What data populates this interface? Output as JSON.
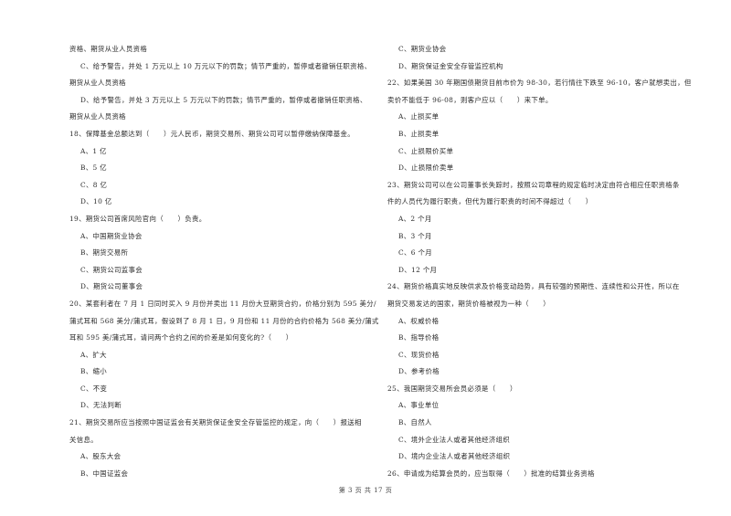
{
  "left_column": {
    "continuation": [
      "资格、期货从业人员资格"
    ],
    "q17_options_cd": [
      {
        "label": "C",
        "text": "C、给予警告，并处 1 万元以上 10 万元以下的罚款；情节严重的，暂停或者撤销任职资格、",
        "cont": "期货从业人员资格"
      },
      {
        "label": "D",
        "text": "D、给予警告，并处 3 万元以上 5 万元以下的罚款；情节严重的，暂停或者撤销任职资格、",
        "cont": "期货从业人员资格"
      }
    ],
    "q18": {
      "stem": "18、保障基金总额达到（　　）元人民币，期货交易所、期货公司可以暂停缴纳保障基金。",
      "options": [
        "A、1 亿",
        "B、5 亿",
        "C、8 亿",
        "D、10 亿"
      ]
    },
    "q19": {
      "stem": "19、期货公司首席风险官向（　　）负责。",
      "options": [
        "A、中国期货业协会",
        "B、期货交易所",
        "C、期货公司监事会",
        "D、期货公司董事会"
      ]
    },
    "q20": {
      "stem_lines": [
        "20、某套利者在 7 月 1 日同时买入 9 月份并卖出 11 月份大豆期货合约，价格分别为 595 美分/",
        "蒲式耳和 568 美分/蒲式耳，假设到了 8 月 1 日，9 月份和 11 月份的合约价格为 568 美分/蒲式",
        "耳和 595 美/蒲式耳，请问两个合约之间的价差是如何变化的?（　　）"
      ],
      "options": [
        "A、扩大",
        "B、缩小",
        "C、不变",
        "D、无法判断"
      ]
    },
    "q21": {
      "stem_lines": [
        "21、期货交易所应当按照中国证监会有关期货保证金安全存管监控的规定，向（　　）报送相",
        "关信息。"
      ],
      "options": [
        "A、股东大会",
        "B、中国证监会"
      ]
    }
  },
  "right_column": {
    "q21_options_cd": [
      "C、期货业协会",
      "D、期货保证金安全存管监控机构"
    ],
    "q22": {
      "stem_lines": [
        "22、如果美国 30 年期国债期货目前市价为 98-30，若行情往下跌至 96-10，客户就想卖出，但",
        "卖价不能低于 96-08，则客户应以（　　）来下单。"
      ],
      "options": [
        "A、止损买单",
        "B、止损卖单",
        "C、止损限价买单",
        "D、止损限价卖单"
      ]
    },
    "q23": {
      "stem_lines": [
        "23、期货公司可以在公司董事长失踪时，按照公司章程的规定临时决定由符合相应任职资格条",
        "件的人员代为履行职责，但代为履行职责的时间不得超过（　　）"
      ],
      "options": [
        "A、2 个月",
        "B、3 个月",
        "C、6 个月",
        "D、12 个月"
      ]
    },
    "q24": {
      "stem_lines": [
        "24、期货价格真实地反映供求及价格变动趋势，具有较强的预期性、连续性和公开性，所以在",
        "期货交易发达的国家，期货价格被视为一种（　　）"
      ],
      "options": [
        "A、权威价格",
        "B、指导价格",
        "C、现货价格",
        "D、参考价格"
      ]
    },
    "q25": {
      "stem": "25、我国期货交易所会员必须是（　　）",
      "options": [
        "A、事业单位",
        "B、自然人",
        "C、境外企业法人或者其他经济组织",
        "D、境内企业法人或者其他经济组织"
      ]
    },
    "q26": {
      "stem": "26、申请成为结算会员的，应当取得（　　）批准的结算业务资格"
    }
  },
  "footer": {
    "page_label": "第 3 页 共 17 页"
  }
}
